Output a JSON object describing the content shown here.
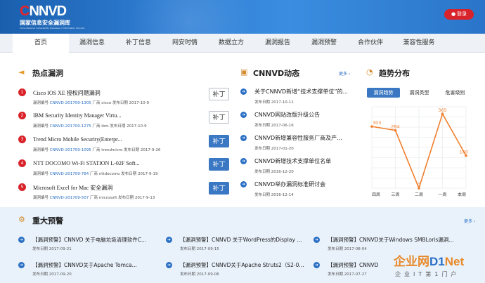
{
  "header": {
    "logo_text": "CNNVD",
    "logo_cn": "国家信息安全漏洞库",
    "logo_en": "China National Vulnerability Database of Information Security",
    "login_label": "登录"
  },
  "nav": {
    "items": [
      "首页",
      "漏洞信息",
      "补丁信息",
      "网安时情",
      "数据立方",
      "漏洞报告",
      "漏洞预警",
      "合作伙伴",
      "兼容性服务"
    ]
  },
  "hot": {
    "title": "热点漏洞",
    "id_label": "漏洞编号",
    "vendor_label": "厂商",
    "date_label": "发布日期",
    "patch_label": "补丁",
    "items": [
      {
        "num": "1",
        "title": "Cisco IOS XE 授权问题漏洞",
        "id": "CNNVD-201709-1305",
        "vendor": "cisco",
        "date": "2017-10-9"
      },
      {
        "num": "2",
        "title": "IBM Security Identity Manager Virtu...",
        "id": "CNNVD-201709-1275",
        "vendor": "ibm",
        "date": "2017-10-9"
      },
      {
        "num": "3",
        "title": "Trend Micro Mobile Security(Enterpr...",
        "id": "CNNVD-201709-1095",
        "vendor": "trendmicro",
        "date": "2017-9-26"
      },
      {
        "num": "4",
        "title": "NTT DOCOMO Wi-Fi STATION L-02F Soft...",
        "id": "CNNVD-201709-784",
        "vendor": "nttdocomo",
        "date": "2017-9-19"
      },
      {
        "num": "5",
        "title": "Microsoft Excel for Mac 安全漏洞",
        "id": "CNNVD-201709-507",
        "vendor": "microsoft",
        "date": "2017-9-13"
      }
    ]
  },
  "news": {
    "title": "CNNVD动态",
    "more": "更多 ›",
    "date_label": "发布日期",
    "items": [
      {
        "title": "关于CNNVD新增“技术支撑单位”的...",
        "date": "2017-10-11"
      },
      {
        "title": "CNNVD网站改版升级公告",
        "date": "2017-06-16"
      },
      {
        "title": "CNNVD新增兼容性服务厂商及产...",
        "date": "2017-01-20"
      },
      {
        "title": "CNNVD新增技术支撑单位名单",
        "date": "2016-12-20"
      },
      {
        "title": "CNNVD举办漏洞标准研讨会",
        "date": "2016-12-14"
      }
    ]
  },
  "trend": {
    "title": "趋势分布",
    "tabs": [
      "漏洞趋势",
      "漏洞类型",
      "危害级别"
    ]
  },
  "chart_data": {
    "type": "line",
    "categories": [
      "四周",
      "三周",
      "二周",
      "一周",
      "本周"
    ],
    "values": [
      303,
      284,
      0,
      365,
      160
    ],
    "ylim": [
      0,
      400
    ],
    "yticks": [
      0,
      50,
      100,
      150,
      200,
      250,
      300,
      350,
      400
    ],
    "grid": true,
    "color": "#f07f2e"
  },
  "alerts": {
    "title": "重大预警",
    "more": "更多 ›",
    "date_label": "发布日期",
    "items": [
      {
        "title": "【漏洞预警】CNNVD 关于电脑垃圾清理软件C...",
        "date": "2017-09-21"
      },
      {
        "title": "【漏洞预警】CNNVD 关于WordPress的Display ...",
        "date": "2017-09-15"
      },
      {
        "title": "【漏洞预警】CNNVD关于Windows SMBLoris漏洞...",
        "date": "2017-08-04"
      },
      {
        "title": "【漏洞预警】CNNVD关于Apache Tomca...",
        "date": "2017-09-20"
      },
      {
        "title": "【漏洞预警】CNNVD关于Apache Struts2（S2-0...",
        "date": "2017-09-06"
      },
      {
        "title": "【漏洞预警】CNNVD",
        "date": "2017-07-27"
      }
    ]
  },
  "watermark": {
    "brand": "企业网D1Net",
    "tagline": "企业IT第1门户"
  },
  "colors": {
    "header": "#2f7ed4",
    "accent_red": "#d9232a",
    "link_blue": "#2a6fc4",
    "patch_blue": "#3b78c3",
    "band": "#e9f2fb"
  }
}
